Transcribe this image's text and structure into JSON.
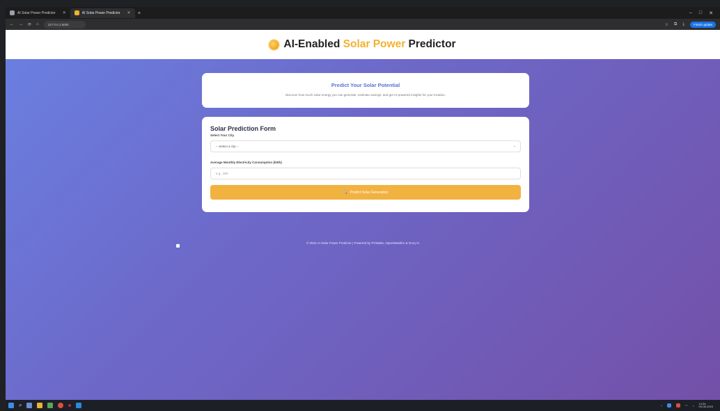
{
  "browser": {
    "tabs": [
      {
        "label": "AI Solar Power Predictor",
        "active": false
      },
      {
        "label": "AI Solar Power Predictor",
        "active": true
      }
    ],
    "new_tab_symbol": "+",
    "window_controls": [
      "–",
      "□",
      "✕"
    ],
    "nav_symbols": [
      "←",
      "→",
      "⟳",
      "⌂"
    ],
    "url": "127.0.0.1:5000",
    "profile_button": "Finish update"
  },
  "header": {
    "icon": "sun-icon",
    "title_prefix": "AI-Enabled",
    "title_highlight": "Solar Power",
    "title_suffix": "Predictor"
  },
  "intro_card": {
    "heading": "Predict Your Solar Potential",
    "description": "Discover how much solar energy you can generate, estimate savings, and get AI-powered insights for your location."
  },
  "form": {
    "title": "Solar Prediction Form",
    "city_label": "Select Your City",
    "city_selected": "-- Select a city --",
    "consumption_label": "Average Monthly Electricity Consumption (kWh)",
    "consumption_placeholder": "e.g., 300",
    "submit_icon": "🔍",
    "submit_label": "Predict Solar Generation"
  },
  "footer": {
    "text": "© 2024 AI Solar Power Predictor | Powered by PVWatts, OpenWeather & Groq AI"
  },
  "taskbar": {
    "tray_time": "14:34",
    "tray_date": "09-06-2024"
  },
  "colors": {
    "accent_yellow": "#f2b22e",
    "heading_blue": "#5a73d6",
    "bg_gradient_start": "#6a7fe0",
    "bg_gradient_end": "#7350a8",
    "button": "#f2b240"
  }
}
